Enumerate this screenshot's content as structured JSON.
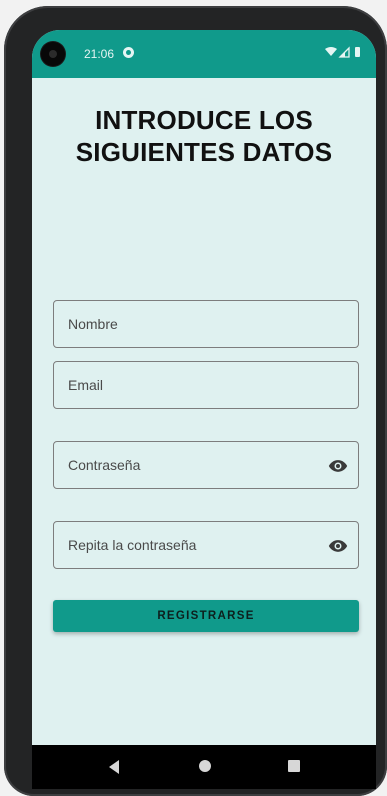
{
  "status_bar": {
    "time": "21:06",
    "background": "#109a8b",
    "icons": [
      "app-notification-icon",
      "wifi-icon",
      "signal-icon",
      "battery-icon"
    ]
  },
  "page": {
    "title_line_1": "INTRODUCE LOS",
    "title_line_2": "SIGUIENTES DATOS",
    "background": "#dff1f0"
  },
  "form": {
    "nombre_label": "Nombre",
    "email_label": "Email",
    "password_label": "Contraseña",
    "repeat_password_label": "Repita la contraseña",
    "submit_label": "REGISTRARSE",
    "accent": "#109a8b"
  },
  "nav_bar": {
    "icons": [
      "back-icon",
      "home-icon",
      "recents-icon"
    ]
  }
}
